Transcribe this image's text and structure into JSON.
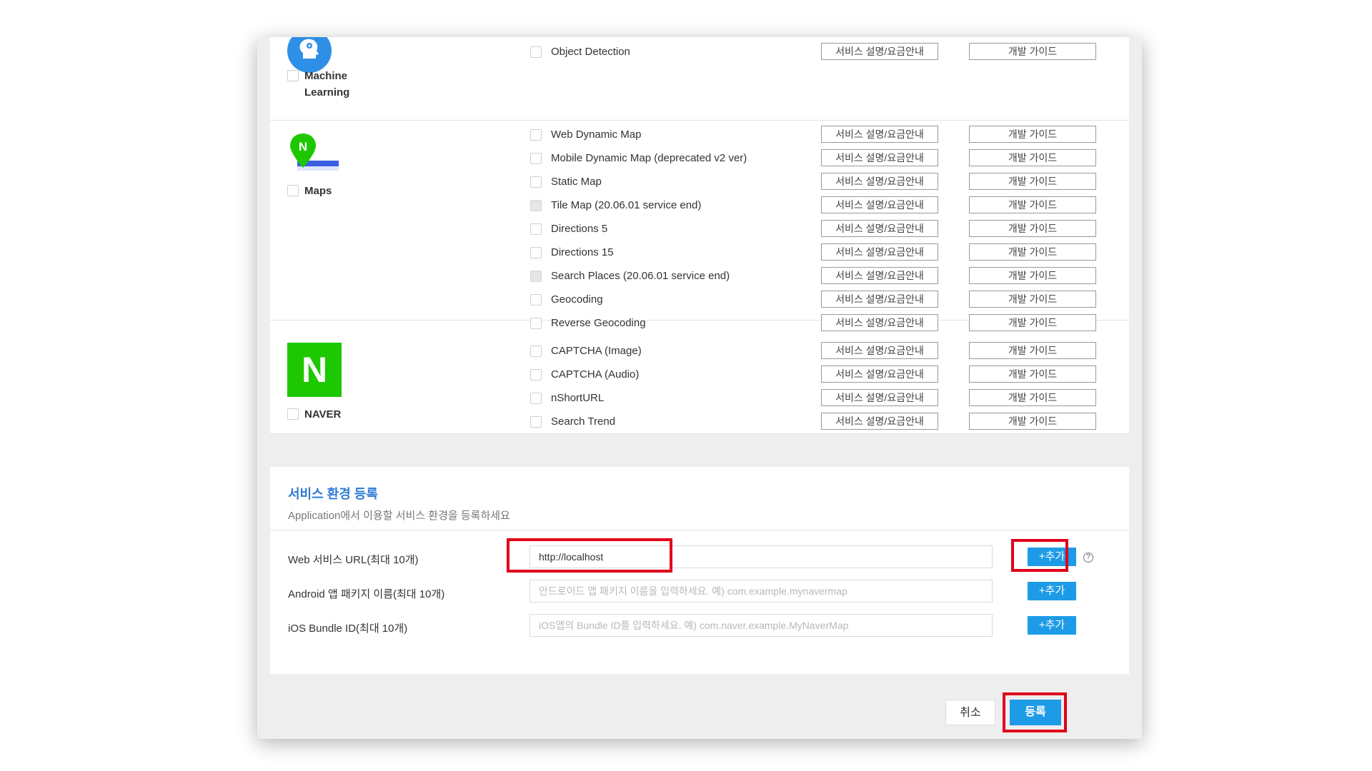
{
  "labels": {
    "service_desc": "서비스 설명/요금안내",
    "dev_guide": "개발 가이드"
  },
  "ml": {
    "name": "Machine Learning",
    "services": [
      {
        "name": "Object Detection"
      }
    ]
  },
  "maps": {
    "name": "Maps",
    "services": [
      {
        "name": "Web Dynamic Map"
      },
      {
        "name": "Mobile Dynamic Map (deprecated v2 ver)"
      },
      {
        "name": "Static Map"
      },
      {
        "name": "Tile Map (20.06.01 service end)"
      },
      {
        "name": "Directions 5"
      },
      {
        "name": "Directions 15"
      },
      {
        "name": "Search Places (20.06.01 service end)"
      },
      {
        "name": "Geocoding"
      },
      {
        "name": "Reverse Geocoding"
      }
    ]
  },
  "naver": {
    "name": "NAVER",
    "logo_letter": "N",
    "services": [
      {
        "name": "CAPTCHA (Image)"
      },
      {
        "name": "CAPTCHA (Audio)"
      },
      {
        "name": "nShortURL"
      },
      {
        "name": "Search Trend"
      }
    ]
  },
  "env": {
    "title": "서비스 환경 등록",
    "subtitle": "Application에서 이용할 서비스 환경을 등록하세요",
    "web": {
      "label": "Web 서비스 URL(최대 10개)",
      "value": "http://localhost",
      "add": "+추가",
      "help": "?"
    },
    "android": {
      "label": "Android 앱 패키지 이름(최대 10개)",
      "placeholder": "안드로이드 앱 패키지 이름을 입력하세요. 예) com.example.mynavermap",
      "add": "+추가"
    },
    "ios": {
      "label": "iOS Bundle ID(최대 10개)",
      "placeholder": "iOS앱의 Bundle ID를 입력하세요. 예) com.naver.example.MyNaverMap",
      "add": "+추가"
    }
  },
  "actions": {
    "cancel": "취소",
    "register": "등록"
  },
  "colors": {
    "accent": "#1e9be6",
    "highlight": "#e0001a",
    "naver_green": "#1ec800",
    "maps_pin": "#1ec800",
    "maps_road": "#3b5fe0",
    "ml_icon": "#2e8fe6"
  }
}
